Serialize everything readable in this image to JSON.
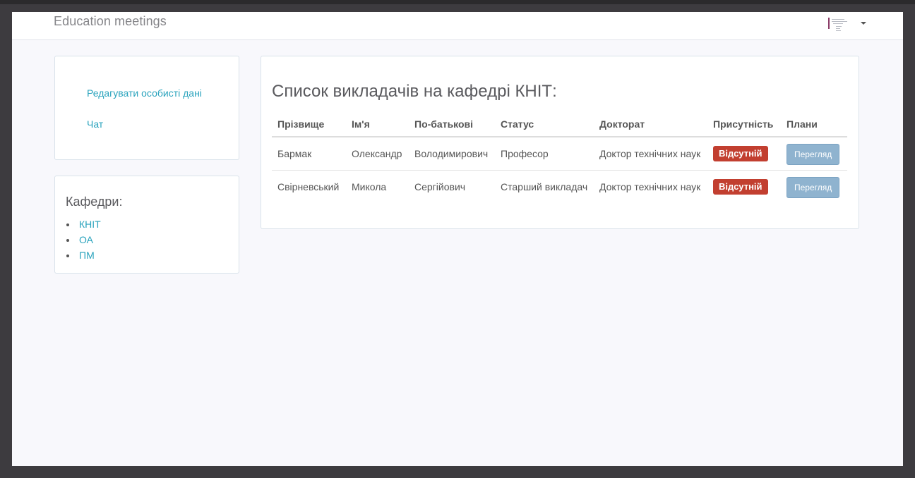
{
  "navbar": {
    "brand": "Education meetings"
  },
  "sidebar": {
    "actions": [
      {
        "label": "Редагувати особисті дані"
      },
      {
        "label": "Чат"
      }
    ],
    "departments": {
      "title": "Кафедри:",
      "items": [
        "КНІТ",
        "ОА",
        "ПМ"
      ]
    }
  },
  "main": {
    "title": "Список викладачів на кафедрі КНІТ:",
    "columns": [
      "Прізвище",
      "Ім'я",
      "По-батькові",
      "Статус",
      "Докторат",
      "Присутність",
      "Плани"
    ],
    "rows": [
      {
        "surname": "Бармак",
        "name": "Олександр",
        "patronymic": "Володимирович",
        "status": "Професор",
        "doctorate": "Доктор технічних наук",
        "presence": "Відсутній",
        "plans": "Перегляд"
      },
      {
        "surname": "Свірневський",
        "name": "Микола",
        "patronymic": "Сергійович",
        "status": "Старший викладач",
        "doctorate": "Доктор технічних наук",
        "presence": "Відсутній",
        "plans": "Перегляд"
      }
    ]
  },
  "colors": {
    "link": "#2aa3bd",
    "absent_badge": "#c23f30",
    "view_button": "#8fb3cf",
    "backdrop": "#3d3b3f"
  }
}
